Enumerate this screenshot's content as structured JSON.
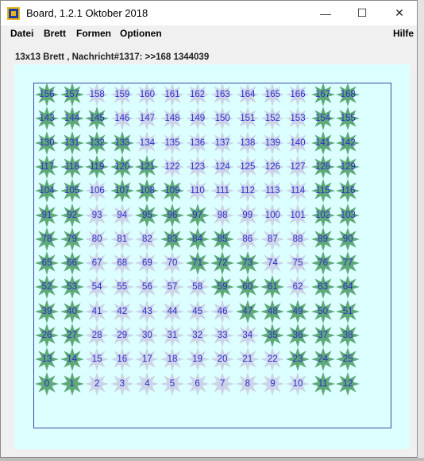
{
  "window": {
    "title": "Board, 1.2.1 Oktober 2018",
    "minimize_glyph": "—",
    "maximize_glyph": "☐",
    "close_glyph": "✕"
  },
  "menu": {
    "datei": "Datei",
    "brett": "Brett",
    "formen": "Formen",
    "optionen": "Optionen",
    "hilfe": "Hilfe"
  },
  "info_label": "13x13 Brett , Nachricht#1317: >>168 1344039",
  "board": {
    "rows": 13,
    "cols": 13,
    "colors": {
      "on": "#5fa878",
      "off": "#cdd4e8",
      "number": "#2c2ccc",
      "frame": "#4048a8",
      "background": "#dcffff"
    },
    "green_cells": [
      0,
      1,
      11,
      12,
      13,
      14,
      23,
      24,
      25,
      26,
      27,
      35,
      36,
      37,
      38,
      39,
      40,
      47,
      48,
      49,
      50,
      51,
      52,
      53,
      59,
      60,
      61,
      63,
      64,
      65,
      66,
      71,
      72,
      73,
      76,
      77,
      78,
      79,
      83,
      84,
      85,
      89,
      90,
      91,
      92,
      95,
      96,
      97,
      102,
      103,
      104,
      105,
      107,
      108,
      109,
      115,
      116,
      117,
      118,
      119,
      120,
      121,
      128,
      129,
      130,
      131,
      132,
      133,
      141,
      142,
      143,
      144,
      145,
      154,
      155,
      156,
      157,
      167,
      168
    ]
  }
}
